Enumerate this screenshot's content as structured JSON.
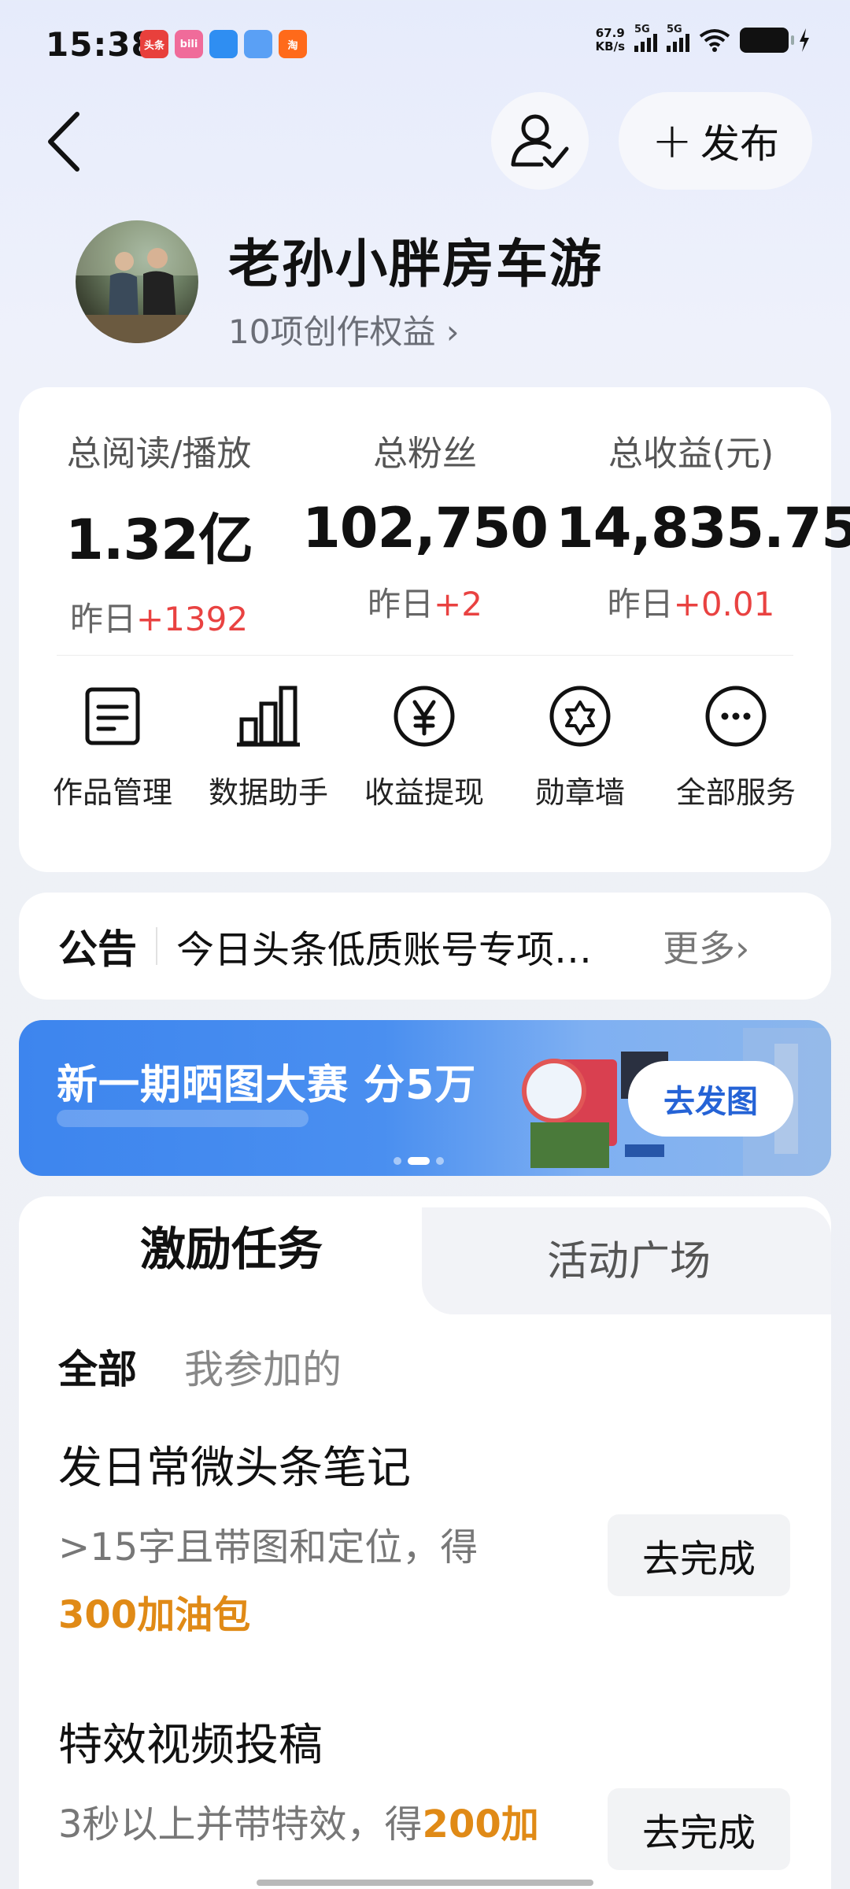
{
  "status_bar": {
    "time": "15:38",
    "net_speed_value": "67.9",
    "net_speed_unit": "KB/s",
    "signal1_label": "5G",
    "signal2_label": "5G",
    "notification_icons": [
      {
        "name": "toutiao-icon",
        "text": "头条",
        "color": "#e8403c"
      },
      {
        "name": "bilibili-icon",
        "text": "bili",
        "color": "#f06b9a"
      },
      {
        "name": "browser-icon",
        "text": "",
        "color": "#2f8ef2"
      },
      {
        "name": "mail-icon",
        "text": "",
        "color": "#5aa0f5"
      },
      {
        "name": "taobao-icon",
        "text": "淘",
        "color": "#ff6a1a"
      }
    ]
  },
  "header": {
    "publish_label": "发布"
  },
  "profile": {
    "name": "老孙小胖房车游",
    "rights_label": "10项创作权益 ›"
  },
  "stats": [
    {
      "label": "总阅读/播放",
      "value": "1.32亿",
      "delta_prefix": "昨日",
      "delta": "+1392"
    },
    {
      "label": "总粉丝",
      "value": "102,750",
      "delta_prefix": "昨日",
      "delta": "+2"
    },
    {
      "label": "总收益(元)",
      "value": "14,835.75",
      "delta_prefix": "昨日",
      "delta": "+0.01"
    }
  ],
  "services": [
    {
      "label": "作品管理",
      "icon": "document-icon"
    },
    {
      "label": "数据助手",
      "icon": "bar-chart-icon"
    },
    {
      "label": "收益提现",
      "icon": "yen-icon"
    },
    {
      "label": "勋章墙",
      "icon": "badge-icon"
    },
    {
      "label": "全部服务",
      "icon": "more-icon"
    }
  ],
  "notice": {
    "title": "公告",
    "text": "今日头条低质账号专项…",
    "more": "更多›"
  },
  "banner": {
    "title": "新一期晒图大赛 分5万",
    "button": "去发图"
  },
  "tasks_section": {
    "tabs": [
      "激励任务",
      "活动广场"
    ],
    "filters": [
      "全部",
      "我参加的"
    ],
    "tasks": [
      {
        "name": "发日常微头条笔记",
        "desc": ">15字且带图和定位，得",
        "reward": "300加油包",
        "button": "去完成"
      },
      {
        "name": "特效视频投稿",
        "desc": "3秒以上并带特效，得",
        "reward": "200加",
        "button": "去完成"
      }
    ]
  },
  "colors": {
    "accent_red": "#e94241",
    "reward_orange": "#e08a16",
    "banner_blue": "#3d85ee"
  }
}
